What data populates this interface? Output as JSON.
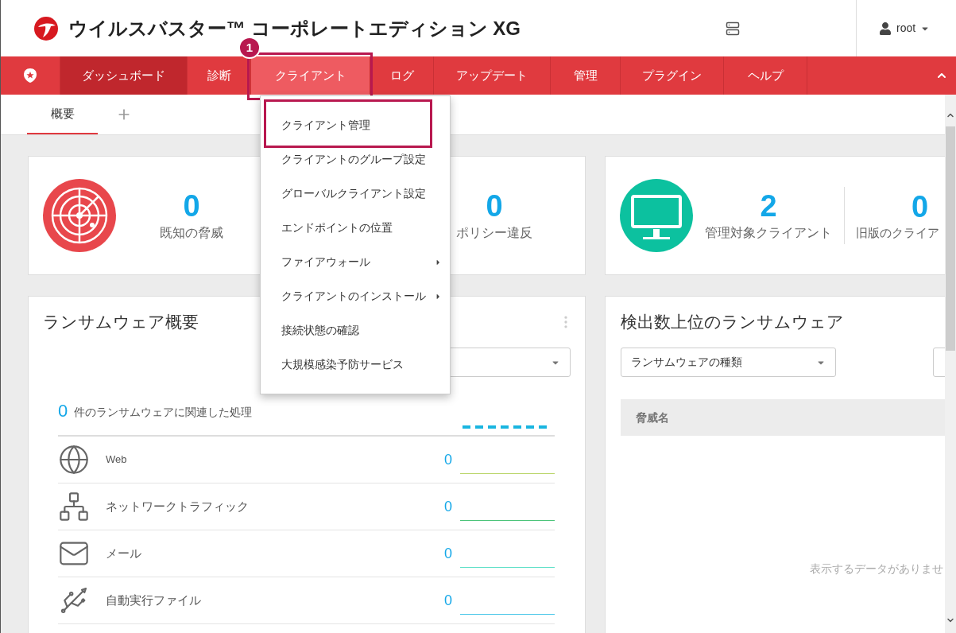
{
  "header": {
    "title": "ウイルスバスター™ コーポレートエディション XG",
    "user": "root"
  },
  "nav": [
    {
      "label": "ダッシュボード",
      "selected": true,
      "open": false,
      "annotated": false
    },
    {
      "label": "診断",
      "selected": false,
      "open": false,
      "annotated": false
    },
    {
      "label": "クライアント",
      "selected": false,
      "open": true,
      "annotated": true
    },
    {
      "label": "ログ",
      "selected": false,
      "open": false,
      "annotated": false
    },
    {
      "label": "アップデート",
      "selected": false,
      "open": false,
      "annotated": false
    },
    {
      "label": "管理",
      "selected": false,
      "open": false,
      "annotated": false
    },
    {
      "label": "プラグイン",
      "selected": false,
      "open": false,
      "annotated": false
    },
    {
      "label": "ヘルプ",
      "selected": false,
      "open": false,
      "annotated": false
    }
  ],
  "annotation": {
    "number": "1"
  },
  "tabs": [
    {
      "label": "概要",
      "selected": true
    }
  ],
  "client_menu": [
    {
      "label": "クライアント管理",
      "submenu": false,
      "annotated": true
    },
    {
      "label": "クライアントのグループ設定",
      "submenu": false,
      "annotated": false
    },
    {
      "label": "グローバルクライアント設定",
      "submenu": false,
      "annotated": false
    },
    {
      "label": "エンドポイントの位置",
      "submenu": false,
      "annotated": false
    },
    {
      "label": "ファイアウォール",
      "submenu": true,
      "annotated": false
    },
    {
      "label": "クライアントのインストール",
      "submenu": true,
      "annotated": false
    },
    {
      "label": "接続状態の確認",
      "submenu": false,
      "annotated": false
    },
    {
      "label": "大規模感染予防サービス",
      "submenu": false,
      "annotated": false
    }
  ],
  "threat_stats": [
    {
      "value": "0",
      "label": "既知の脅威"
    },
    {
      "value": "0",
      "label": "ポリシー違反"
    }
  ],
  "client_stats": [
    {
      "value": "2",
      "label": "管理対象クライアント"
    },
    {
      "value": "0",
      "label": "旧版のクライア"
    }
  ],
  "ransomware_summary": {
    "title": "ランサムウェア概要",
    "total": "0",
    "total_label": "件のランサムウェアに関連した処理",
    "rows": [
      {
        "kind": "web",
        "label": "Web",
        "value": "0",
        "color": "#bcd66e"
      },
      {
        "kind": "network",
        "label": "ネットワークトラフィック",
        "value": "0",
        "color": "#4cc47a"
      },
      {
        "kind": "mail",
        "label": "メール",
        "value": "0",
        "color": "#5ee0c8"
      },
      {
        "kind": "autorun",
        "label": "自動実行ファイル",
        "value": "0",
        "color": "#48c6e8"
      }
    ]
  },
  "top_ransomware": {
    "title": "検出数上位のランサムウェア",
    "filter": "ランサムウェアの種類",
    "columns": [
      "脅威名"
    ],
    "empty_text": "表示するデータがありませ"
  }
}
